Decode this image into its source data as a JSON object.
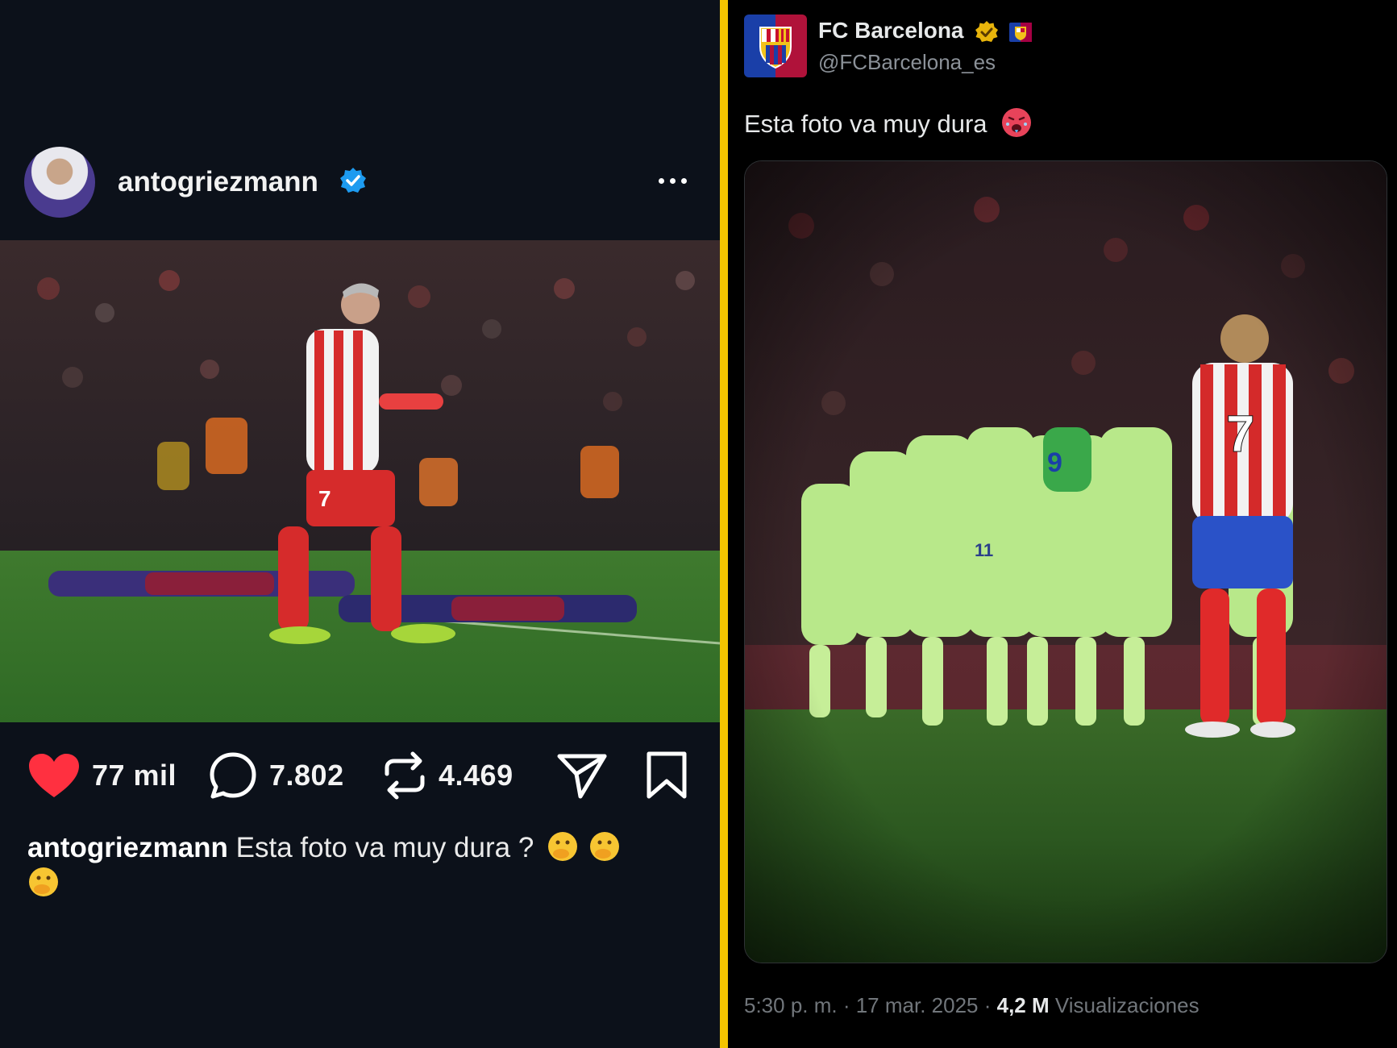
{
  "instagram_post": {
    "username": "antogriezmann",
    "avatar_icon": "profile-photo",
    "verified_icon": "verified-blue-check-icon",
    "more_icon": "more-horizontal-icon",
    "photo_description_icon": "celebration-photo",
    "likes_count": "77 mil",
    "comments_count": "7.802",
    "reposts_count": "4.469",
    "caption_username": "antogriezmann",
    "caption_text": "Esta foto va muy dura ?",
    "colors": {
      "like_red": "#ff3040",
      "background": "#0c111a",
      "verified_blue": "#1d9bf0"
    }
  },
  "tweet": {
    "display_name": "FC Barcelona",
    "handle": "@FCBarcelona_es",
    "text": "Esta foto va muy dura",
    "gold_badge_icon": "gold-verified-badge-icon",
    "flag_icon": "club-flag-icon",
    "emoji_icon": "hot-face-emoji",
    "timestamp": "5:30 p. m. · 17 mar. 2025 · ",
    "views_count": "4,2 M",
    "views_label": " Visualizaciones",
    "colors": {
      "gold": "#e8b40b",
      "divider": "#f4c400",
      "muted": "#71767b"
    }
  }
}
